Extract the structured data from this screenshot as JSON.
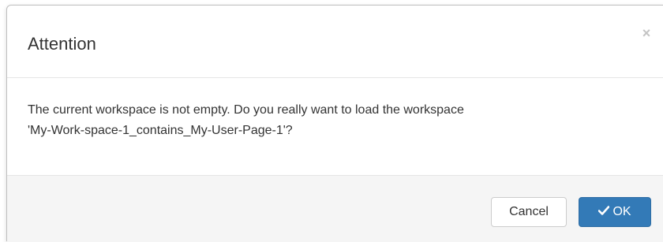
{
  "dialog": {
    "title": "Attention",
    "close_glyph": "×",
    "message_line1": "The current workspace is not empty. Do you really want to load the workspace",
    "message_line2": "'My-Work-space-1_contains_My-User-Page-1'?",
    "cancel_label": "Cancel",
    "ok_label": "OK",
    "ok_icon": "check-icon"
  },
  "colors": {
    "primary": "#337ab7",
    "footer_bg": "#f5f5f5",
    "text": "#333333"
  }
}
